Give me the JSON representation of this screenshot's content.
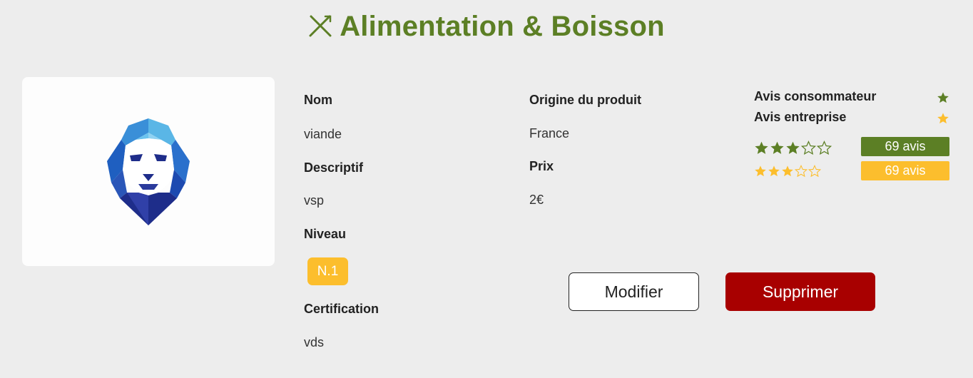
{
  "header": {
    "title": "Alimentation & Boisson",
    "icon": "fork-knife-icon",
    "color": "#5c7f25"
  },
  "product": {
    "image_icon": "lion-logo",
    "fields": {
      "name_label": "Nom",
      "name_value": "viande",
      "description_label": "Descriptif",
      "description_value": "vsp",
      "level_label": "Niveau",
      "level_value": "N.1",
      "certification_label": "Certification",
      "certification_value": "vds",
      "origin_label": "Origine du produit",
      "origin_value": "France",
      "price_label": "Prix",
      "price_value": "2€"
    }
  },
  "reviews": {
    "consumer": {
      "label": "Avis consommateur",
      "rating": 3,
      "max_rating": 5,
      "count_label": "69 avis",
      "color": "#5c7f25"
    },
    "business": {
      "label": "Avis entreprise",
      "rating": 3,
      "max_rating": 5,
      "count_label": "69 avis",
      "color": "#fcbe2d"
    }
  },
  "actions": {
    "modify_label": "Modifier",
    "delete_label": "Supprimer",
    "delete_color": "#a80000"
  }
}
